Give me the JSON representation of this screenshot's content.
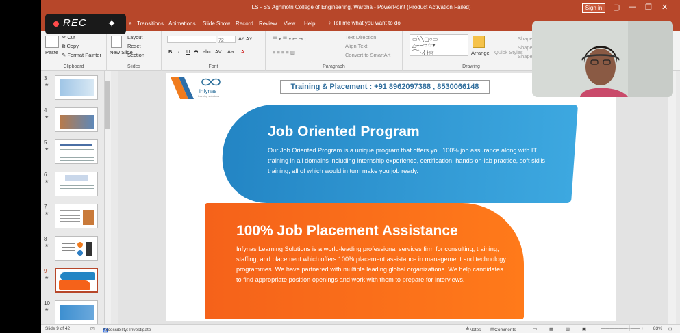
{
  "window": {
    "title": "ILS - SS Agnihotri College of Engineering, Wardha  -  PowerPoint (Product Activation Failed)",
    "sign_in": "Sign in"
  },
  "recording": {
    "label": "REC",
    "icon": "sparkle-icon"
  },
  "tabs": [
    "e",
    "Transitions",
    "Animations",
    "Slide Show",
    "Record",
    "Review",
    "View",
    "Help"
  ],
  "tell_me": "Tell me what you want to do",
  "ribbon": {
    "clipboard": {
      "paste": "Paste",
      "cut": "Cut",
      "copy": "Copy",
      "format_painter": "Format Painter",
      "label": "Clipboard"
    },
    "slides": {
      "new_slide": "New Slide",
      "layout": "Layout",
      "reset": "Reset",
      "section": "Section",
      "label": "Slides"
    },
    "font": {
      "size": "72",
      "bold": "B",
      "italic": "I",
      "underline": "U",
      "strike": "S",
      "shadow": "abc",
      "spacing": "AV",
      "case": "Aa",
      "color": "A",
      "label": "Font"
    },
    "paragraph": {
      "text_direction": "Text Direction",
      "align_text": "Align Text",
      "smartart": "Convert to SmartArt",
      "label": "Paragraph"
    },
    "drawing": {
      "arrange": "Arrange",
      "quick_styles": "Quick Styles",
      "shape_fill": "Shape",
      "shape_outline": "Shape",
      "shape_effects": "Shape",
      "label": "Drawing"
    }
  },
  "thumbnails": [
    {
      "num": "3",
      "selected": false
    },
    {
      "num": "4",
      "selected": false
    },
    {
      "num": "5",
      "selected": false
    },
    {
      "num": "6",
      "selected": false
    },
    {
      "num": "7",
      "selected": false
    },
    {
      "num": "8",
      "selected": false
    },
    {
      "num": "9",
      "selected": true
    },
    {
      "num": "10",
      "selected": false
    }
  ],
  "slide": {
    "logo": "infynas",
    "logo_sub": "learning solutions",
    "banner": "Training & Placement : +91 8962097388 , 8530066148",
    "blue_title": "Job Oriented Program",
    "blue_body": "Our Job Oriented Program is a unique program that offers you 100% job assurance along with IT training in all domains including internship experience, certification, hands-on-lab practice, soft skills training, all of which would in turn make you job ready.",
    "orange_title": "100% Job Placement Assistance",
    "orange_body": "Infynas Learning Solutions is a world-leading professional services firm for consulting, training, staffing, and placement which offers 100% placement assistance in management and technology programmes. We have partnered with multiple leading global organizations.  We help candidates to find appropriate position openings and work with them to prepare for interviews.",
    "colors": {
      "blue": "#2385c4",
      "orange": "#f5621a",
      "banner_text": "#2f6d9c"
    }
  },
  "status": {
    "slide_count": "Slide 9 of 42",
    "accessibility": "Accessibility: Investigate",
    "notes": "Notes",
    "comments": "Comments",
    "zoom": "83%"
  }
}
